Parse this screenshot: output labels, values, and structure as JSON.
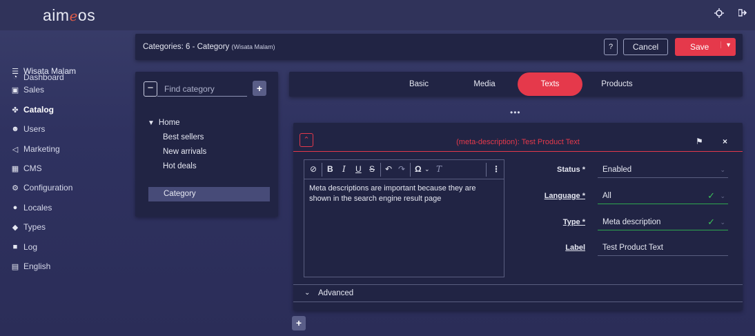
{
  "app": {
    "logo_left": "aim",
    "logo_mid": "e",
    "logo_right": "os",
    "brand_color": "#e5394b"
  },
  "topbar": {
    "theme_icon": "sun-icon",
    "logout_icon": "logout-icon"
  },
  "sidebar": {
    "items": [
      {
        "label": "Wisata Malam",
        "icon": "list-icon"
      },
      {
        "label": "Dashboard",
        "icon": "dashboard-icon"
      },
      {
        "label": "Sales",
        "icon": "money-icon"
      },
      {
        "label": "Catalog",
        "icon": "catalog-icon",
        "active": true
      },
      {
        "label": "Users",
        "icon": "users-icon"
      },
      {
        "label": "Marketing",
        "icon": "megaphone-icon"
      },
      {
        "label": "CMS",
        "icon": "grid-icon"
      },
      {
        "label": "Configuration",
        "icon": "gears-icon"
      },
      {
        "label": "Locales",
        "icon": "globe-icon"
      },
      {
        "label": "Types",
        "icon": "tag-icon"
      },
      {
        "label": "Log",
        "icon": "log-icon"
      },
      {
        "label": "English",
        "icon": "language-icon"
      }
    ]
  },
  "header": {
    "title": "Categories: 6 - Category",
    "title_small": "(Wisata Malam)",
    "help_label": "?",
    "cancel_label": "Cancel",
    "save_label": "Save"
  },
  "tree": {
    "search_placeholder": "Find category",
    "root": "Home",
    "children": [
      "Best sellers",
      "New arrivals",
      "Hot deals"
    ],
    "selected": "Category"
  },
  "tabs": {
    "items": [
      "Basic",
      "Media",
      "Texts",
      "Products"
    ],
    "active": "Texts",
    "more": "•••"
  },
  "text_item": {
    "title": "(meta-description): Test Product Text",
    "content": "Meta descriptions are important because they are shown in the search engine result page",
    "fields": {
      "status_label": "Status *",
      "status_value": "Enabled",
      "language_label": "Language *",
      "language_value": "All",
      "type_label": "Type *",
      "type_value": "Meta description",
      "label_label": "Label",
      "label_value": "Test Product Text"
    },
    "advanced_label": "Advanced"
  }
}
